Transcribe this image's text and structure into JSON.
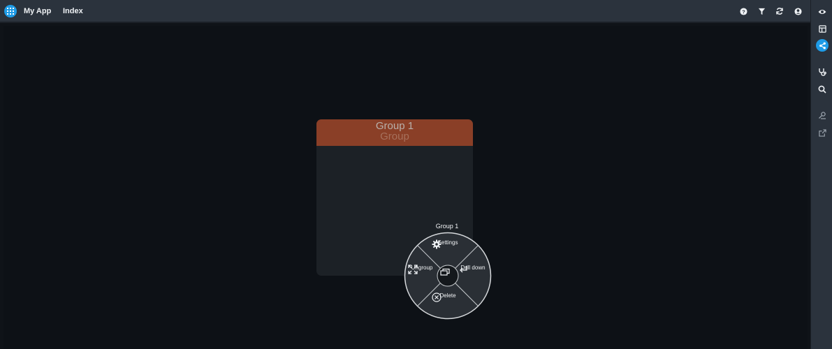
{
  "header": {
    "app_title": "My App",
    "nav_index": "Index",
    "icons": [
      "help-icon",
      "filter-icon",
      "refresh-icon",
      "user-icon"
    ]
  },
  "rail": {
    "icons": [
      "eye-icon",
      "layout-icon",
      "share-icon",
      "stethoscope-icon",
      "search-icon",
      "pin-icon",
      "external-link-icon"
    ],
    "active": "share-icon"
  },
  "group": {
    "title": "Group 1",
    "subtitle": "Group",
    "header_color": "#8a3f27"
  },
  "radial_menu": {
    "title": "Group 1",
    "items": {
      "settings": "Settings",
      "ungroup": "Ungroup",
      "drill_down": "Drill down",
      "delete": "Delete"
    }
  },
  "colors": {
    "accent": "#1e9be6",
    "topbar": "#2b333d",
    "canvas": "#0d1116"
  }
}
